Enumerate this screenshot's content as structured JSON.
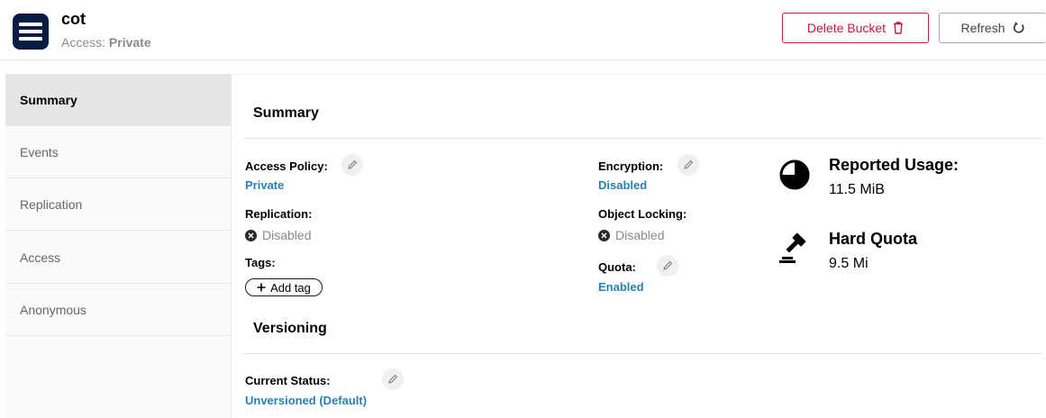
{
  "header": {
    "bucket_name": "cot",
    "access_label": "Access:",
    "access_value": "Private",
    "delete_label": "Delete Bucket",
    "refresh_label": "Refresh"
  },
  "sidebar": {
    "items": [
      {
        "label": "Summary"
      },
      {
        "label": "Events"
      },
      {
        "label": "Replication"
      },
      {
        "label": "Access"
      },
      {
        "label": "Anonymous"
      }
    ]
  },
  "summary": {
    "title": "Summary",
    "access_policy_label": "Access Policy:",
    "access_policy_value": "Private",
    "replication_label": "Replication:",
    "replication_value": "Disabled",
    "tags_label": "Tags:",
    "add_tag_label": "Add tag",
    "encryption_label": "Encryption:",
    "encryption_value": "Disabled",
    "object_locking_label": "Object Locking:",
    "object_locking_value": "Disabled",
    "quota_label": "Quota:",
    "quota_value": "Enabled"
  },
  "usage": {
    "reported_title": "Reported Usage:",
    "reported_value": "11.5 MiB",
    "quota_title": "Hard Quota",
    "quota_value": "9.5 Mi"
  },
  "versioning": {
    "title": "Versioning",
    "status_label": "Current Status:",
    "status_value": "Unversioned (Default)"
  },
  "colors": {
    "accent_link": "#2781b0",
    "danger": "#c51b3a",
    "brand_dark": "#081c42"
  }
}
